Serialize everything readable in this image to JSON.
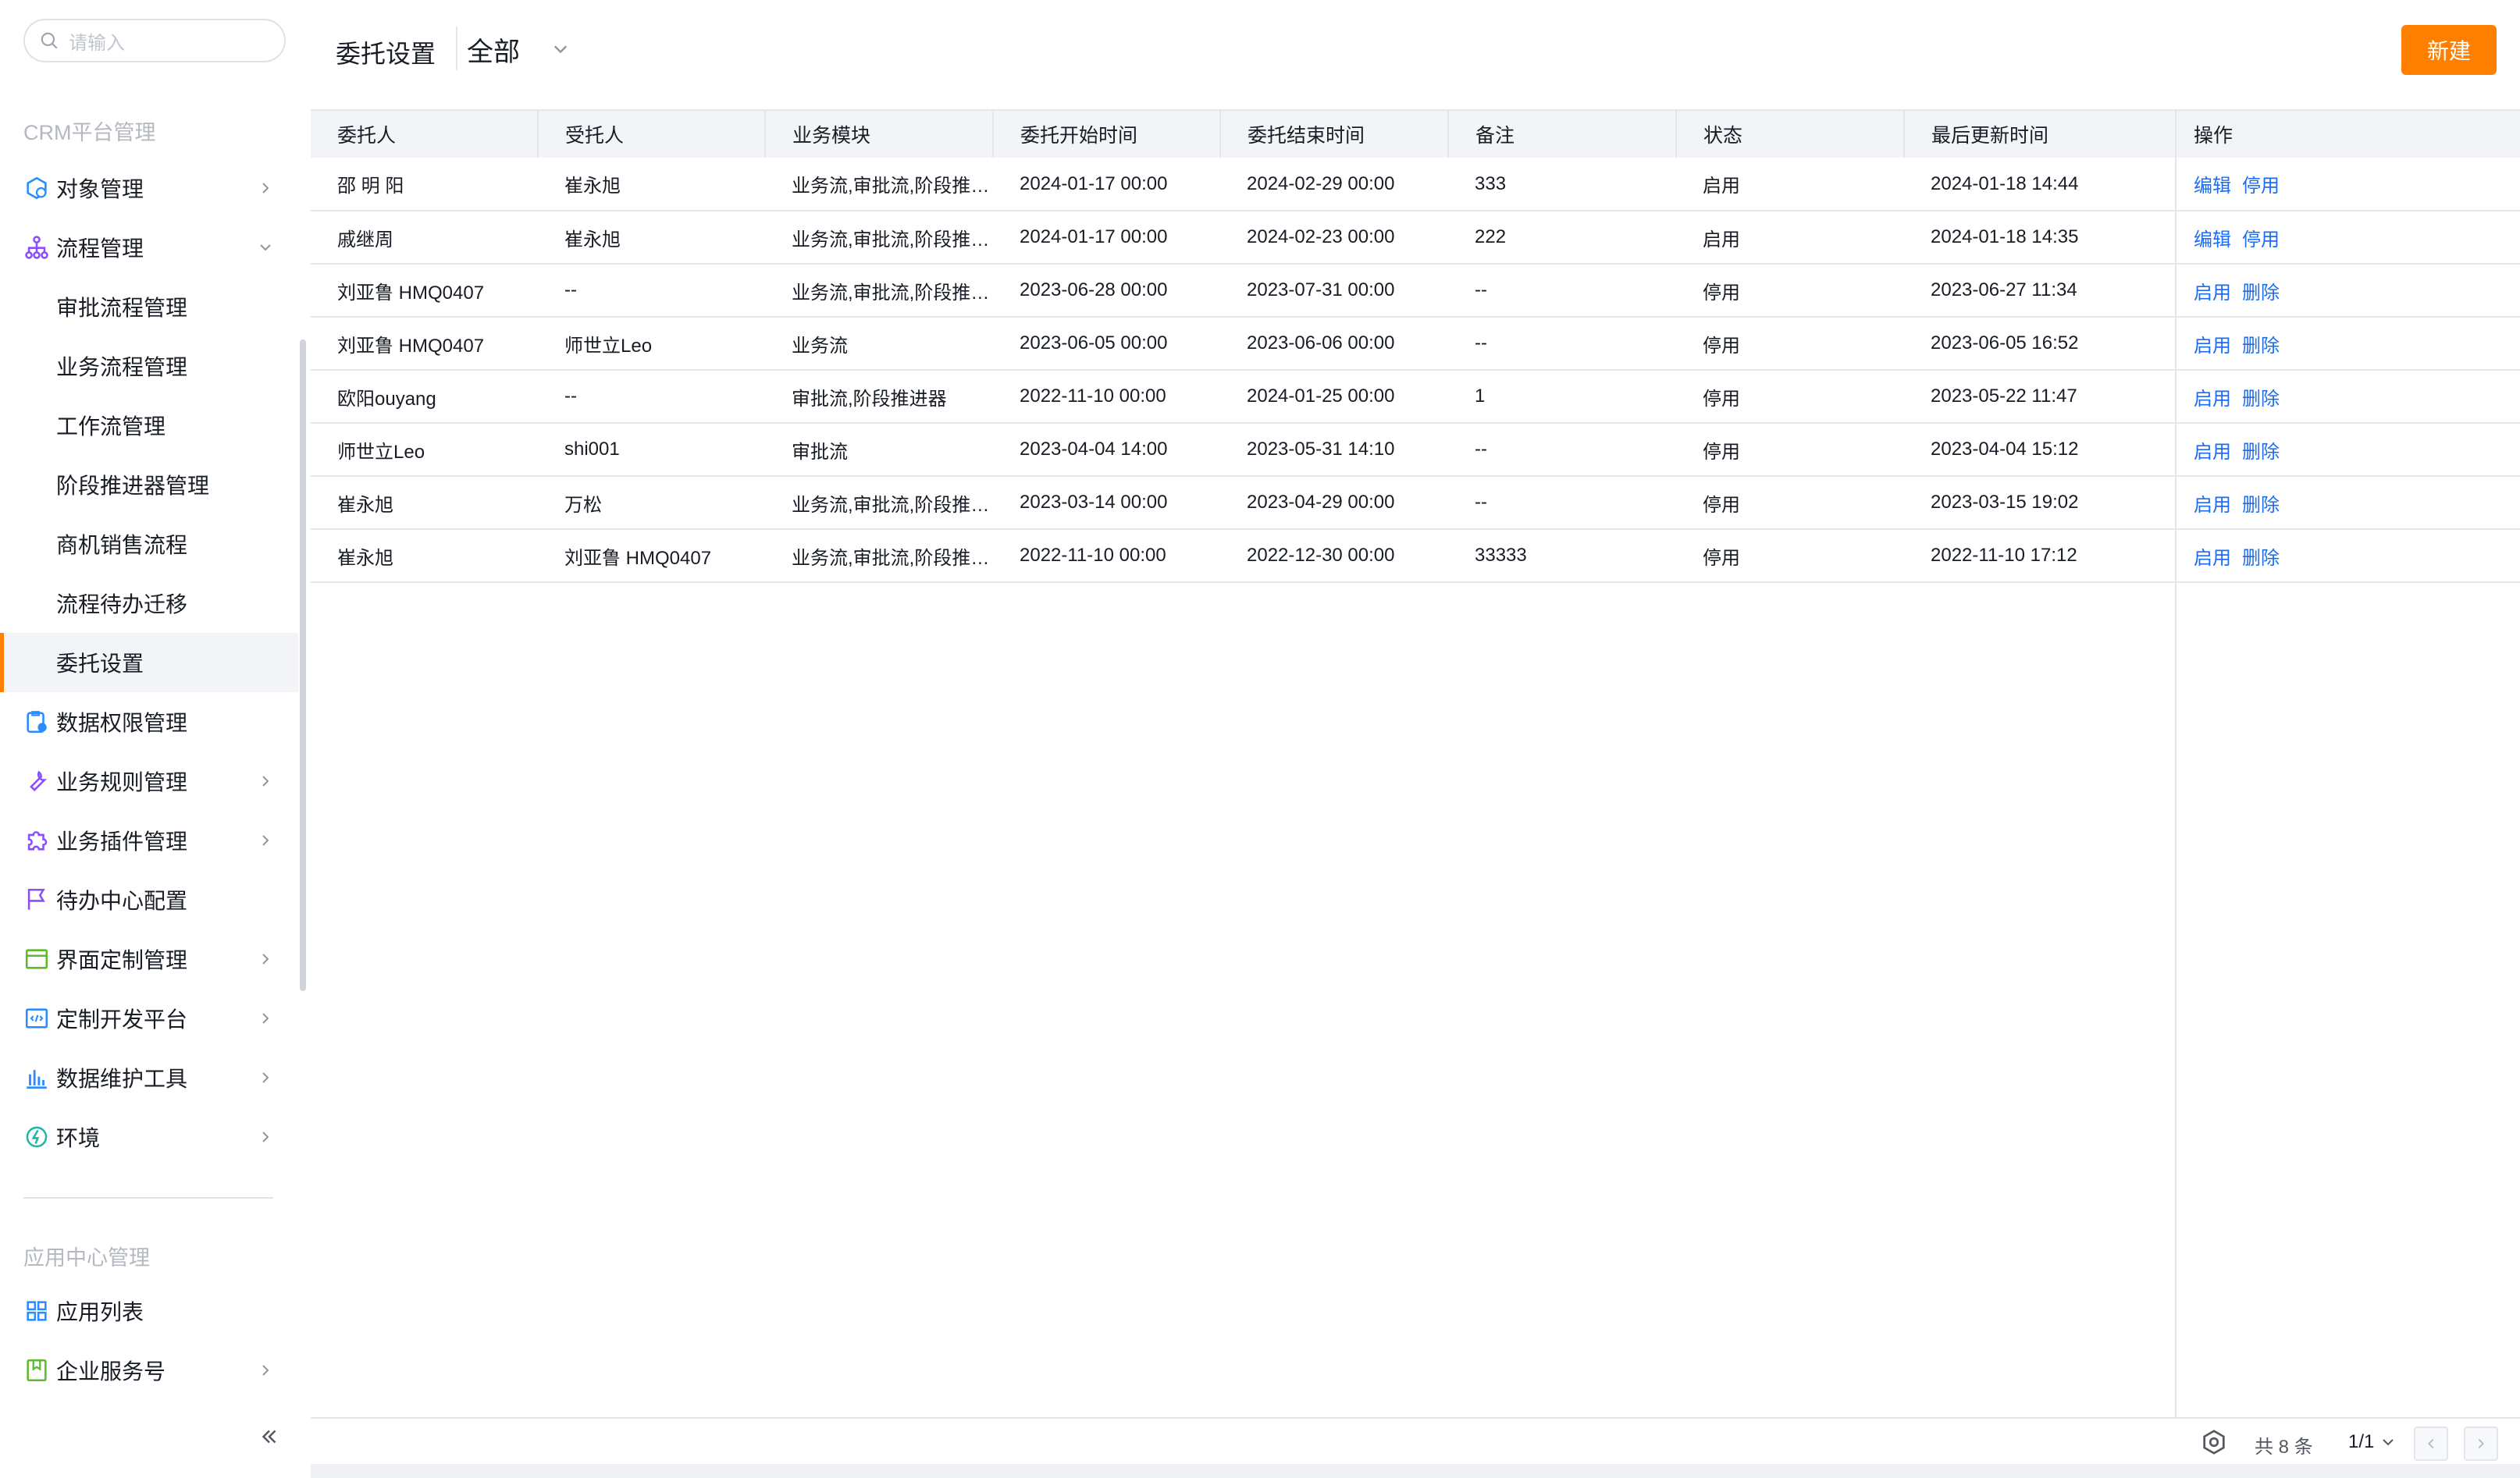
{
  "search": {
    "placeholder": "请输入"
  },
  "sidebar": {
    "crm_section": "CRM平台管理",
    "app_section": "应用中心管理",
    "items": [
      {
        "label": "对象管理",
        "icon": "object-icon"
      },
      {
        "label": "流程管理",
        "icon": "flow-icon"
      },
      {
        "label": "审批流程管理"
      },
      {
        "label": "业务流程管理"
      },
      {
        "label": "工作流管理"
      },
      {
        "label": "阶段推进器管理"
      },
      {
        "label": "商机销售流程"
      },
      {
        "label": "流程待办迁移"
      },
      {
        "label": "委托设置"
      },
      {
        "label": "数据权限管理",
        "icon": "data-permission-icon"
      },
      {
        "label": "业务规则管理",
        "icon": "wrench-icon"
      },
      {
        "label": "业务插件管理",
        "icon": "puzzle-icon"
      },
      {
        "label": "待办中心配置",
        "icon": "flag-icon"
      },
      {
        "label": "界面定制管理",
        "icon": "window-icon"
      },
      {
        "label": "定制开发平台",
        "icon": "code-icon"
      },
      {
        "label": "数据维护工具",
        "icon": "bar-chart-icon"
      },
      {
        "label": "环境",
        "icon": "environment-icon"
      },
      {
        "label": "应用列表",
        "icon": "grid-icon"
      },
      {
        "label": "企业服务号",
        "icon": "bookmark-icon"
      }
    ]
  },
  "header": {
    "title": "委托设置",
    "filter": "全部",
    "new_button": "新建"
  },
  "table": {
    "columns": [
      "委托人",
      "受托人",
      "业务模块",
      "委托开始时间",
      "委托结束时间",
      "备注",
      "状态",
      "最后更新时间",
      "操作"
    ],
    "rows": [
      {
        "principal": "邵 明 阳",
        "trustee": "崔永旭",
        "module": "业务流,审批流,阶段推进器",
        "start": "2024-01-17 00:00",
        "end": "2024-02-29 00:00",
        "note": "333",
        "status": "启用",
        "updated": "2024-01-18 14:44",
        "action1": "编辑",
        "action2": "停用"
      },
      {
        "principal": "戚继周",
        "trustee": "崔永旭",
        "module": "业务流,审批流,阶段推进器",
        "start": "2024-01-17 00:00",
        "end": "2024-02-23 00:00",
        "note": "222",
        "status": "启用",
        "updated": "2024-01-18 14:35",
        "action1": "编辑",
        "action2": "停用"
      },
      {
        "principal": "刘亚鲁 HMQ0407",
        "trustee": "--",
        "module": "业务流,审批流,阶段推进器",
        "start": "2023-06-28 00:00",
        "end": "2023-07-31 00:00",
        "note": "--",
        "status": "停用",
        "updated": "2023-06-27 11:34",
        "action1": "启用",
        "action2": "删除"
      },
      {
        "principal": "刘亚鲁 HMQ0407",
        "trustee": "师世立Leo",
        "module": "业务流",
        "start": "2023-06-05 00:00",
        "end": "2023-06-06 00:00",
        "note": "--",
        "status": "停用",
        "updated": "2023-06-05 16:52",
        "action1": "启用",
        "action2": "删除"
      },
      {
        "principal": "欧阳ouyang",
        "trustee": "--",
        "module": "审批流,阶段推进器",
        "start": "2022-11-10 00:00",
        "end": "2024-01-25 00:00",
        "note": "1",
        "status": "停用",
        "updated": "2023-05-22 11:47",
        "action1": "启用",
        "action2": "删除"
      },
      {
        "principal": "师世立Leo",
        "trustee": "shi001",
        "module": "审批流",
        "start": "2023-04-04 14:00",
        "end": "2023-05-31 14:10",
        "note": "--",
        "status": "停用",
        "updated": "2023-04-04 15:12",
        "action1": "启用",
        "action2": "删除"
      },
      {
        "principal": "崔永旭",
        "trustee": "万松",
        "module": "业务流,审批流,阶段推进器",
        "start": "2023-03-14 00:00",
        "end": "2023-04-29 00:00",
        "note": "--",
        "status": "停用",
        "updated": "2023-03-15 19:02",
        "action1": "启用",
        "action2": "删除"
      },
      {
        "principal": "崔永旭",
        "trustee": "刘亚鲁 HMQ0407",
        "module": "业务流,审批流,阶段推进器",
        "start": "2022-11-10 00:00",
        "end": "2022-12-30 00:00",
        "note": "33333",
        "status": "停用",
        "updated": "2022-11-10 17:12",
        "action1": "启用",
        "action2": "删除"
      }
    ]
  },
  "footer": {
    "total": "共 8 条",
    "page": "1/1"
  },
  "colors": {
    "accent": "#ff8000",
    "link": "#1d6cf2"
  }
}
